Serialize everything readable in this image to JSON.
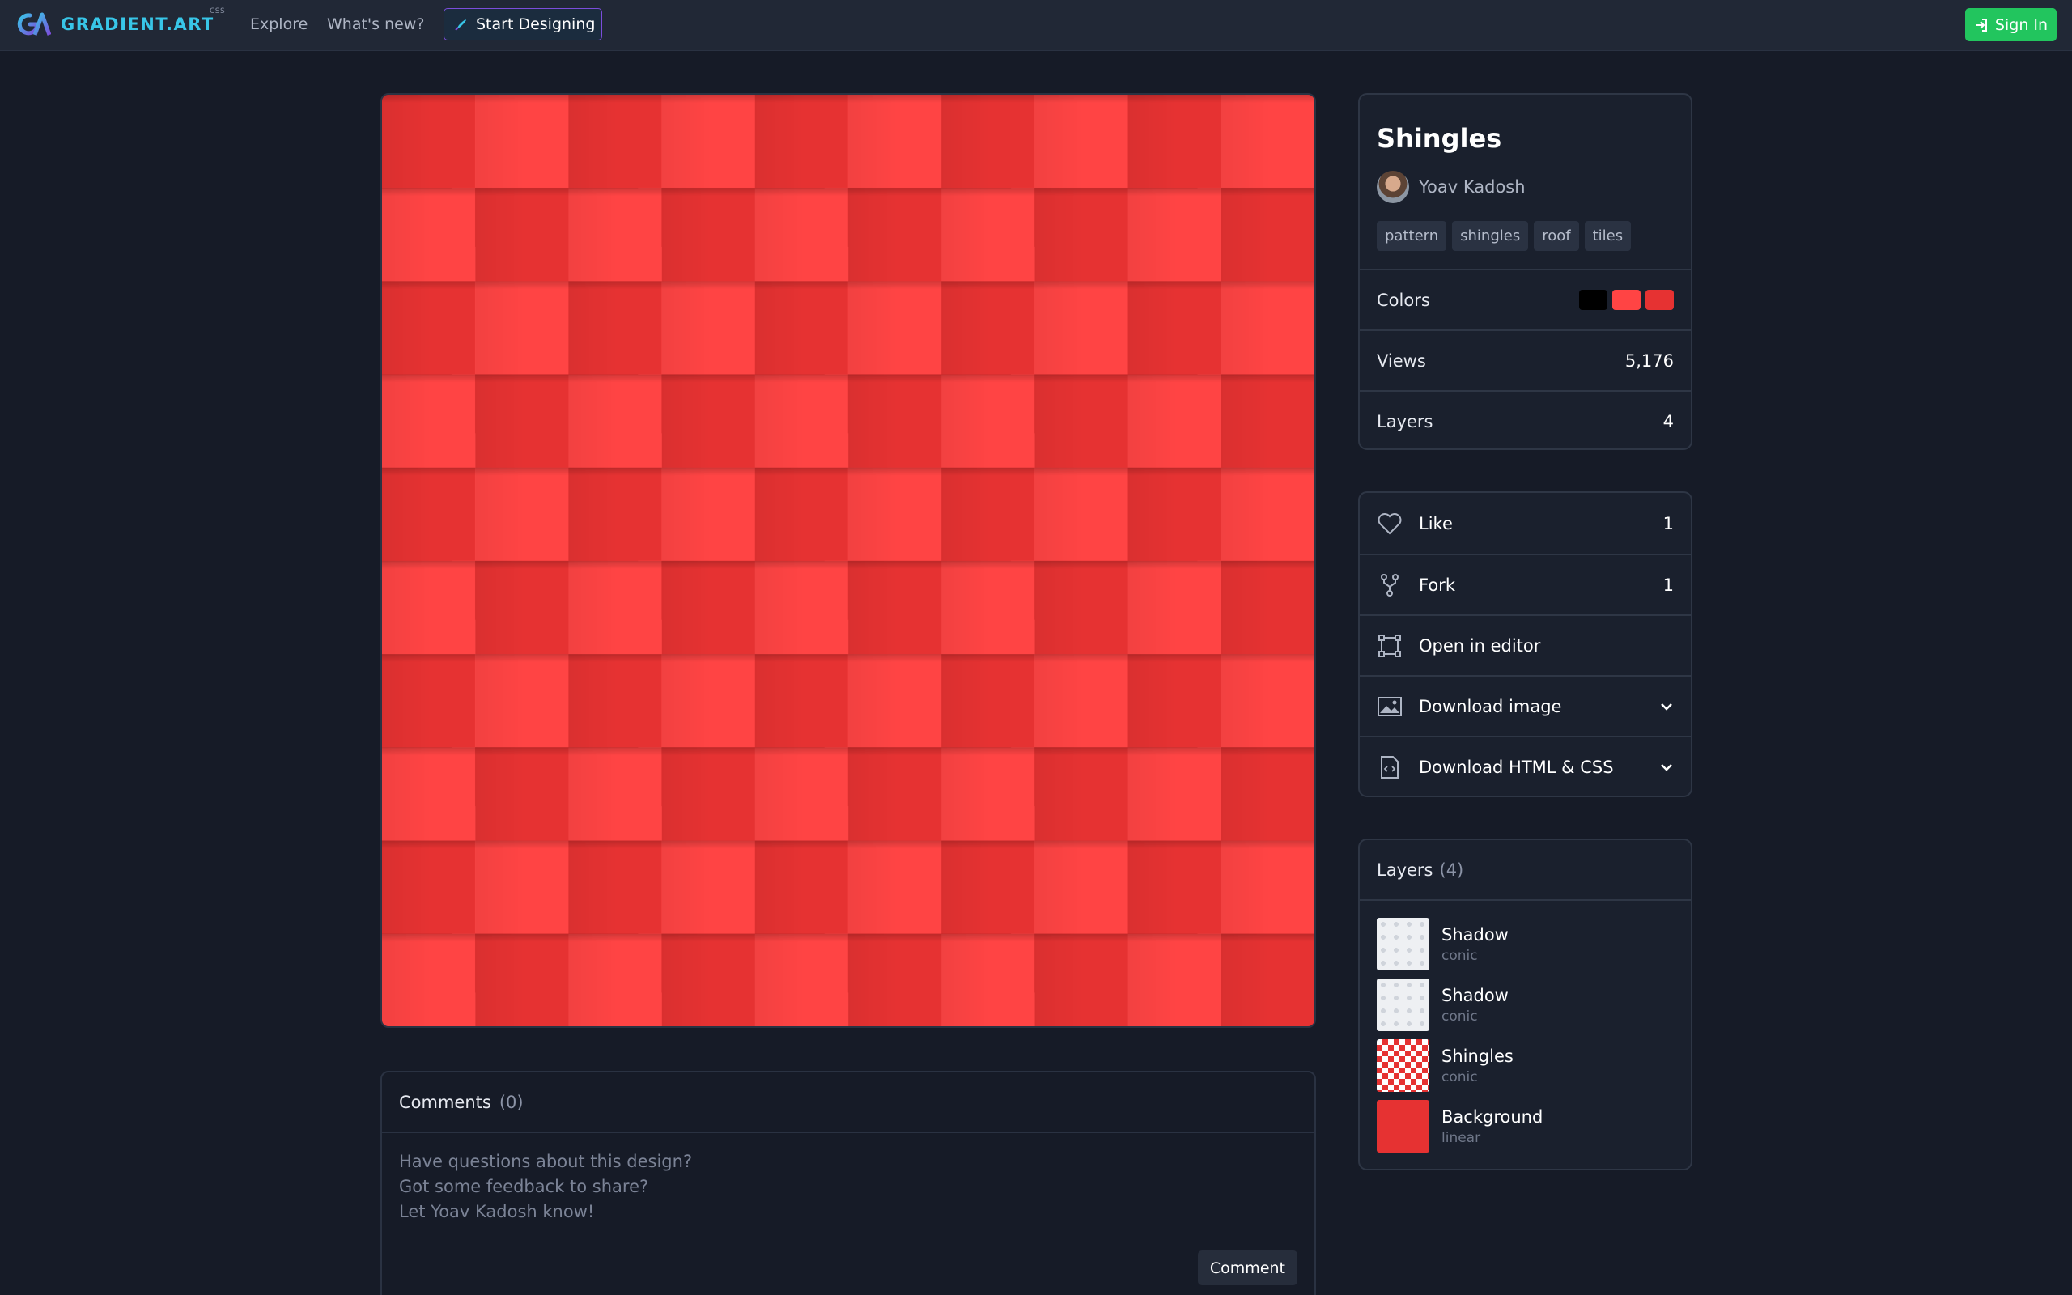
{
  "app": {
    "logo_text": "GRADIENT.ART",
    "logo_sup": "CSS"
  },
  "nav": {
    "explore": "Explore",
    "whats_new": "What's new?",
    "start_designing": "Start Designing",
    "sign_in": "Sign In"
  },
  "design": {
    "title": "Shingles",
    "author": "Yoav Kadosh",
    "tags": [
      "pattern",
      "shingles",
      "roof",
      "tiles"
    ],
    "colors_label": "Colors",
    "colors": [
      "#000000",
      "#ff4444",
      "#e63232"
    ],
    "views_label": "Views",
    "views": "5,176",
    "layers_label": "Layers",
    "layers_count": "4"
  },
  "actions": {
    "like_label": "Like",
    "like_count": "1",
    "fork_label": "Fork",
    "fork_count": "1",
    "open_editor": "Open in editor",
    "download_image": "Download image",
    "download_html": "Download HTML & CSS"
  },
  "layers_panel": {
    "title": "Layers",
    "count": "(4)",
    "items": [
      {
        "name": "Shadow",
        "type": "conic"
      },
      {
        "name": "Shadow",
        "type": "conic"
      },
      {
        "name": "Shingles",
        "type": "conic"
      },
      {
        "name": "Background",
        "type": "linear"
      }
    ]
  },
  "comments": {
    "title": "Comments",
    "count": "(0)",
    "placeholder_line1": "Have questions about this design?",
    "placeholder_line2": "Got some feedback to share?",
    "placeholder_line3": "Let Yoav Kadosh know!",
    "button": "Comment"
  },
  "theme": {
    "accent": "#22c55e",
    "brand": "#38c6e8",
    "pattern_light": "#ff4444",
    "pattern_dark": "#e63232"
  }
}
